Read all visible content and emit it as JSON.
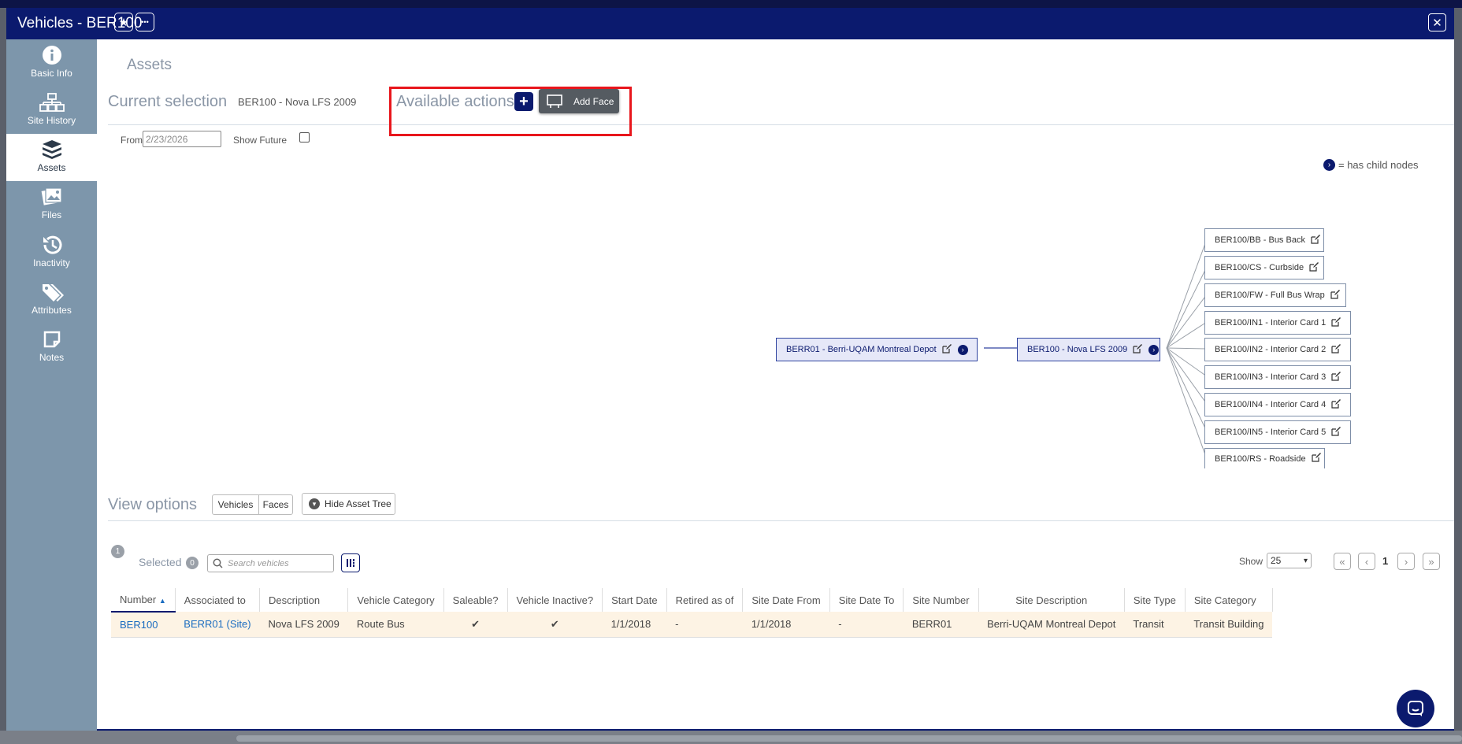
{
  "window": {
    "title": "Vehicles - BER100",
    "favorite_glyph": "★",
    "more_glyph": "•••",
    "close_glyph": "✕"
  },
  "sidebar": {
    "items": [
      {
        "label": "Basic Info",
        "icon": "info-icon"
      },
      {
        "label": "Site History",
        "icon": "site-history-icon"
      },
      {
        "label": "Assets",
        "icon": "boxes-icon",
        "active": true
      },
      {
        "label": "Files",
        "icon": "images-icon"
      },
      {
        "label": "Inactivity",
        "icon": "history-clock-icon"
      },
      {
        "label": "Attributes",
        "icon": "tags-icon"
      },
      {
        "label": "Notes",
        "icon": "note-icon"
      }
    ]
  },
  "header": {
    "page_title": "Assets",
    "current_selection_label": "Current selection",
    "current_selection_value": "BER100 - Nova LFS 2009",
    "available_actions_label": "Available actions",
    "add_plus_glyph": "+",
    "add_face_label": "Add Face"
  },
  "filters": {
    "from_label": "From",
    "from_value": "2/23/2026",
    "show_future_label": "Show Future",
    "show_future_checked": false
  },
  "tree": {
    "legend_text": "= has child nodes",
    "root": "BERR01 - Berri-UQAM Montreal Depot",
    "selected": "BER100 - Nova LFS 2009",
    "faces": [
      "BER100/BB - Bus Back",
      "BER100/CS - Curbside",
      "BER100/FW - Full Bus Wrap",
      "BER100/IN1 - Interior Card 1",
      "BER100/IN2 - Interior Card 2",
      "BER100/IN3 - Interior Card 3",
      "BER100/IN4 - Interior Card 4",
      "BER100/IN5 - Interior Card 5",
      "BER100/RS - Roadside"
    ]
  },
  "view_options": {
    "label": "View options",
    "vehicles": "Vehicles",
    "faces": "Faces",
    "hide_tree": "Hide Asset Tree"
  },
  "grid": {
    "count_badge": "1",
    "selected_label": "Selected",
    "selected_count": "0",
    "search_placeholder": "Search vehicles",
    "show_label": "Show",
    "page_size": "25",
    "page": "1",
    "columns": [
      "Number",
      "Associated to",
      "Description",
      "Vehicle Category",
      "Saleable?",
      "Vehicle Inactive?",
      "Start Date",
      "Retired as of",
      "Site Date From",
      "Site Date To",
      "Site Number",
      "Site Description",
      "Site Type",
      "Site Category"
    ],
    "rows": [
      [
        "BER100",
        "BERR01 (Site)",
        "Nova LFS 2009",
        "Route Bus",
        "✔",
        "✔",
        "1/1/2018",
        "-",
        "1/1/2018",
        "-",
        "BERR01",
        "Berri-UQAM Montreal Depot",
        "Transit",
        "Transit Building"
      ]
    ]
  },
  "colors": {
    "brand": "#0b1a6e",
    "sidebar": "#7d96ab",
    "highlight": "#e8161c",
    "row_highlight": "#fdf3e4"
  }
}
